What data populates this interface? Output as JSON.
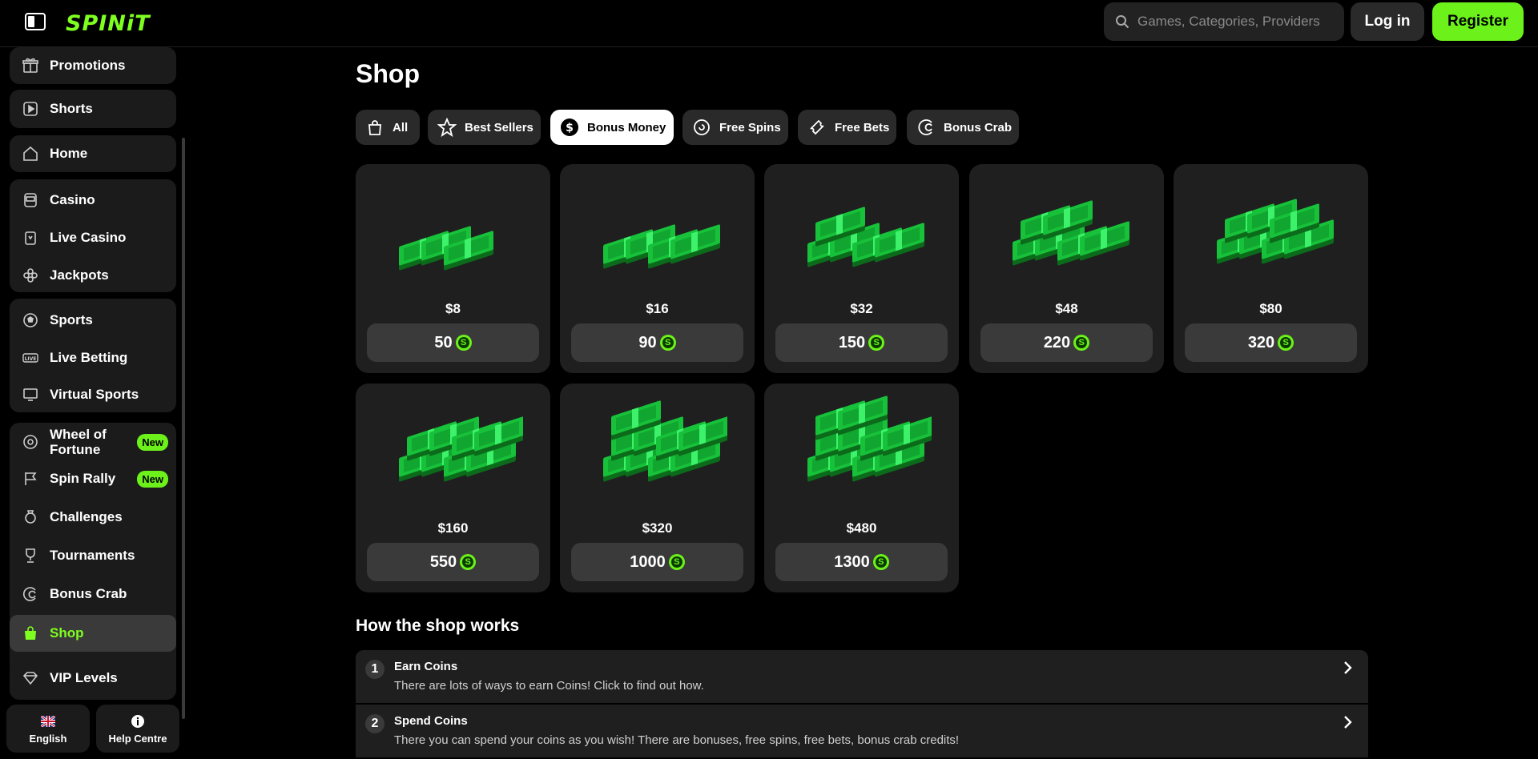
{
  "header": {
    "logo": "SPINiT",
    "search_placeholder": "Games, Categories, Providers",
    "login_label": "Log in",
    "register_label": "Register"
  },
  "sidebar": {
    "items": [
      {
        "label": "Promotions",
        "icon": "gift-icon"
      },
      {
        "label": "Shorts",
        "icon": "play-square-icon"
      },
      {
        "label": "Home",
        "icon": "home-icon"
      },
      {
        "label": "Casino",
        "icon": "slot-machine-icon"
      },
      {
        "label": "Live Casino",
        "icon": "cards-icon"
      },
      {
        "label": "Jackpots",
        "icon": "clover-icon"
      },
      {
        "label": "Sports",
        "icon": "football-icon"
      },
      {
        "label": "Live Betting",
        "icon": "live-icon"
      },
      {
        "label": "Virtual Sports",
        "icon": "monitor-icon"
      },
      {
        "label": "Wheel of Fortune",
        "icon": "wheel-icon",
        "badge": "New"
      },
      {
        "label": "Spin Rally",
        "icon": "flag-icon",
        "badge": "New"
      },
      {
        "label": "Challenges",
        "icon": "medal-icon"
      },
      {
        "label": "Tournaments",
        "icon": "trophy-icon"
      },
      {
        "label": "Bonus Crab",
        "icon": "crab-claw-icon"
      },
      {
        "label": "Shop",
        "icon": "shopping-bag-icon",
        "active": true
      },
      {
        "label": "VIP Levels",
        "icon": "diamond-icon"
      }
    ],
    "footer": {
      "language_label": "English",
      "help_label": "Help Centre"
    }
  },
  "main": {
    "title": "Shop",
    "tabs": [
      {
        "label": "All",
        "icon": "bag-icon"
      },
      {
        "label": "Best Sellers",
        "icon": "star-icon"
      },
      {
        "label": "Bonus Money",
        "icon": "dollar-icon",
        "active": true
      },
      {
        "label": "Free Spins",
        "icon": "spin-icon"
      },
      {
        "label": "Free Bets",
        "icon": "ticket-icon"
      },
      {
        "label": "Bonus Crab",
        "icon": "crab-claw-icon"
      }
    ],
    "products": [
      {
        "price": "$8",
        "coins": "50"
      },
      {
        "price": "$16",
        "coins": "90"
      },
      {
        "price": "$32",
        "coins": "150"
      },
      {
        "price": "$48",
        "coins": "220"
      },
      {
        "price": "$80",
        "coins": "320"
      },
      {
        "price": "$160",
        "coins": "550"
      },
      {
        "price": "$320",
        "coins": "1000"
      },
      {
        "price": "$480",
        "coins": "1300"
      }
    ],
    "coin_symbol": "S",
    "how_title": "How the shop works",
    "steps": [
      {
        "num": "1",
        "title": "Earn Coins",
        "desc": "There are lots of ways to earn Coins! Click to find out how."
      },
      {
        "num": "2",
        "title": "Spend Coins",
        "desc": "There you can spend your coins as you wish! There are bonuses, free spins, free bets, bonus crab credits!"
      }
    ]
  },
  "colors": {
    "accent": "#6cf21a",
    "card_bg": "#1f1f1f",
    "button_bg": "#3a3a3a"
  }
}
